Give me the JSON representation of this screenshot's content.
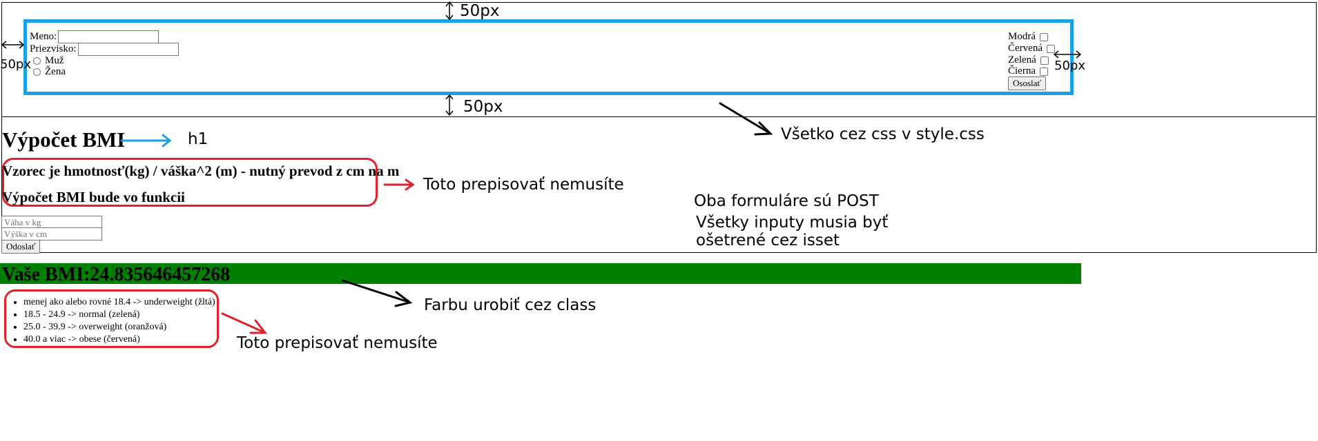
{
  "annotations": {
    "top_margin": "50px",
    "bottom_margin": "50px",
    "left_margin": "50px",
    "right_margin": "50px",
    "css_note": "Všetko cez css v style.css",
    "h1_note": "h1",
    "dont_rewrite_1": "Toto prepisovať nemusíte",
    "post_note": "Oba formuláre sú POST",
    "isset_note_line1": "Všetky inputy musia byť",
    "isset_note_line2": "ošetrené cez isset",
    "class_note": "Farbu urobiť cez class",
    "dont_rewrite_2": "Toto prepisovať nemusíte"
  },
  "form1": {
    "name_label": "Meno:",
    "name_value": "",
    "surname_label": "Priezvisko:",
    "surname_value": "",
    "gender_options": [
      "Muž",
      "Žena"
    ],
    "colors": [
      "Modrá",
      "Červená",
      "Zelená",
      "Čierna"
    ],
    "submit_label": "Ososlať"
  },
  "bmi_section": {
    "title": "Výpočet BMI",
    "formula": "Vzorec je hmotnosť(kg) / váška^2 (m) - nutný prevod z cm na m",
    "function_note": "Výpočet BMI bude vo funkcii",
    "weight_placeholder": "Váha v kg",
    "height_placeholder": "Výška v cm",
    "submit_label": "Odoslať"
  },
  "result": {
    "bmi_text": "Vaše BMI:24.835646457268",
    "bar_color": "#008000",
    "ranges": [
      "menej ako alebo rovné 18.4 -> underweight (žltá)",
      "18.5 - 24.9 -> normal (zelená)",
      "25.0 - 39.9 -> overweight (oranžová)",
      "40.0 a viac -> obese (červená)"
    ]
  },
  "colors": {
    "blue_annotation": "#1aa0e6",
    "red_annotation": "#e0202a",
    "green_result": "#008000"
  }
}
